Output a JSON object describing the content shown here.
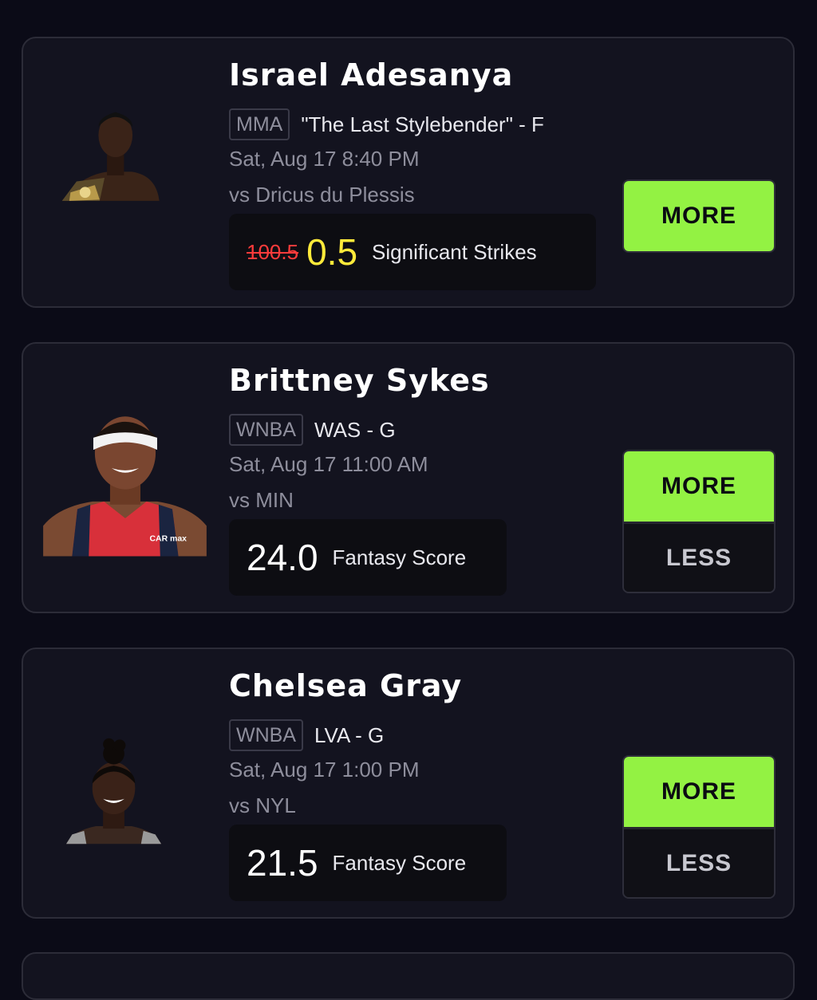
{
  "colors": {
    "background": "#0b0b17",
    "card": "#13131f",
    "more_button": "#93f243",
    "promo_line": "#ffea3a",
    "old_line": "#ff3b3b"
  },
  "cards": [
    {
      "player_name": "Israel Adesanya",
      "league": "MMA",
      "team_position": "\"The Last Stylebender\" - F",
      "game_time": "Sat, Aug 17 8:40 PM",
      "opponent": "vs Dricus du Plessis",
      "old_line": "100.5",
      "line": "0.5",
      "stat": "Significant Strikes",
      "more_label": "MORE",
      "avatar_icon": "fighter-avatar-icon"
    },
    {
      "player_name": "Brittney Sykes",
      "league": "WNBA",
      "team_position": "WAS - G",
      "game_time": "Sat, Aug 17 11:00 AM",
      "opponent": "vs MIN",
      "line": "24.0",
      "stat": "Fantasy Score",
      "more_label": "MORE",
      "less_label": "LESS",
      "jersey_text": "CAR max",
      "avatar_icon": "player-avatar-icon"
    },
    {
      "player_name": "Chelsea Gray",
      "league": "WNBA",
      "team_position": "LVA - G",
      "game_time": "Sat, Aug 17 1:00 PM",
      "opponent": "vs NYL",
      "line": "21.5",
      "stat": "Fantasy Score",
      "more_label": "MORE",
      "less_label": "LESS",
      "avatar_icon": "player-avatar-icon"
    }
  ]
}
